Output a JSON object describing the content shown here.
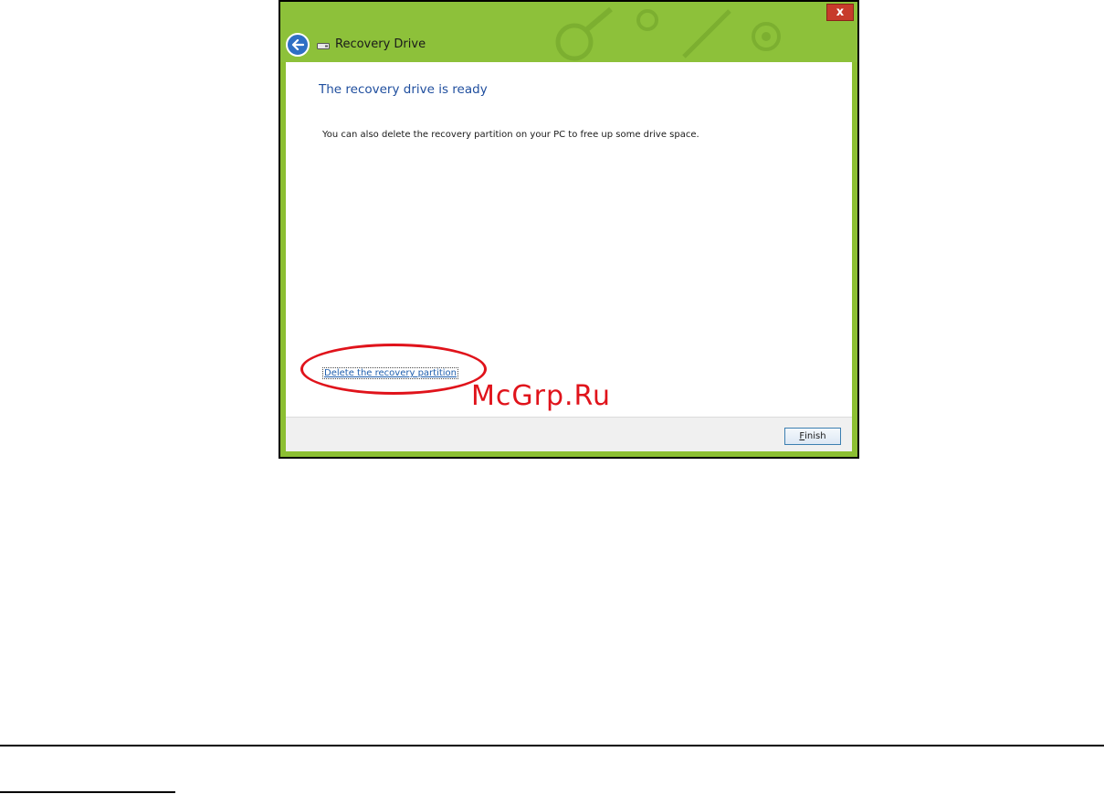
{
  "window": {
    "title": "Recovery Drive",
    "close_glyph": "x",
    "back_icon": "back-arrow-icon",
    "drive_icon": "drive-icon"
  },
  "content": {
    "heading": "The recovery drive is ready",
    "body": "You can also delete the recovery partition on your PC to free up some drive space.",
    "delete_link": "Delete the recovery partition"
  },
  "footer": {
    "finish_accel": "F",
    "finish_rest": "inish"
  },
  "overlay": {
    "watermark": "McGrp.Ru"
  },
  "colors": {
    "titlebar_green": "#8dc13a",
    "heading_blue": "#1f4e9e",
    "link_blue": "#1f5fae",
    "highlight_red": "#e0131b",
    "close_red": "#c73b2b",
    "back_blue": "#2f6fc4"
  }
}
